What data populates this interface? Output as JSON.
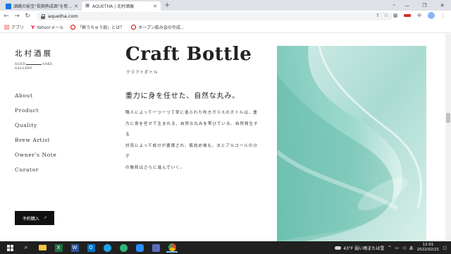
{
  "browser": {
    "tabs": [
      {
        "title": "酒蔵の秘宝\"長期熟成酒\"を新発売!"
      },
      {
        "title": "AQUETHA | 北村酒展"
      }
    ],
    "new_tab_label": "+",
    "window_controls": {
      "minimize": "—",
      "maximize": "❐",
      "close": "✕"
    },
    "url": "aquetha.com",
    "bookmarks": [
      {
        "label": "アプリ"
      },
      {
        "label": "Yahoo!メール"
      },
      {
        "label": "「鮮うちゅう部」とは？"
      },
      {
        "label": "オープン飲み会の作成..."
      }
    ]
  },
  "site": {
    "logo_main": "北村酒展",
    "logo_sub_left": "AGED",
    "logo_sub_right": "SAKE",
    "logo_sub_bottom": "GALLERY",
    "nav": [
      "About",
      "Product",
      "Quality",
      "Brew Artist",
      "Owner's Note",
      "Curator"
    ],
    "reserve_label": "予約購入",
    "reserve_arrow": "↗",
    "heading": "Craft Bottle",
    "subheading": "クラフトボトル",
    "catchphrase": "重力に身を任せた、自然な丸み。",
    "body_lines": [
      "職人によって一つ一つ丁寧に造られた吹きガラスのボトルは、重",
      "力に身を任せて生まれる、自然な丸みを帯びている。自然発生する",
      "対流によって成分が循環され、瓶詰め後も、水とアルコールの分子",
      "の融和はさらに進んでいく。"
    ]
  },
  "taskbar": {
    "weather": "43°F 弱い雨または雪",
    "time": "12:01",
    "date": "2022/02/21",
    "ime": "あ"
  },
  "colors": {
    "accent_dark": "#111111",
    "photo_teal": "#9fd6cc"
  }
}
